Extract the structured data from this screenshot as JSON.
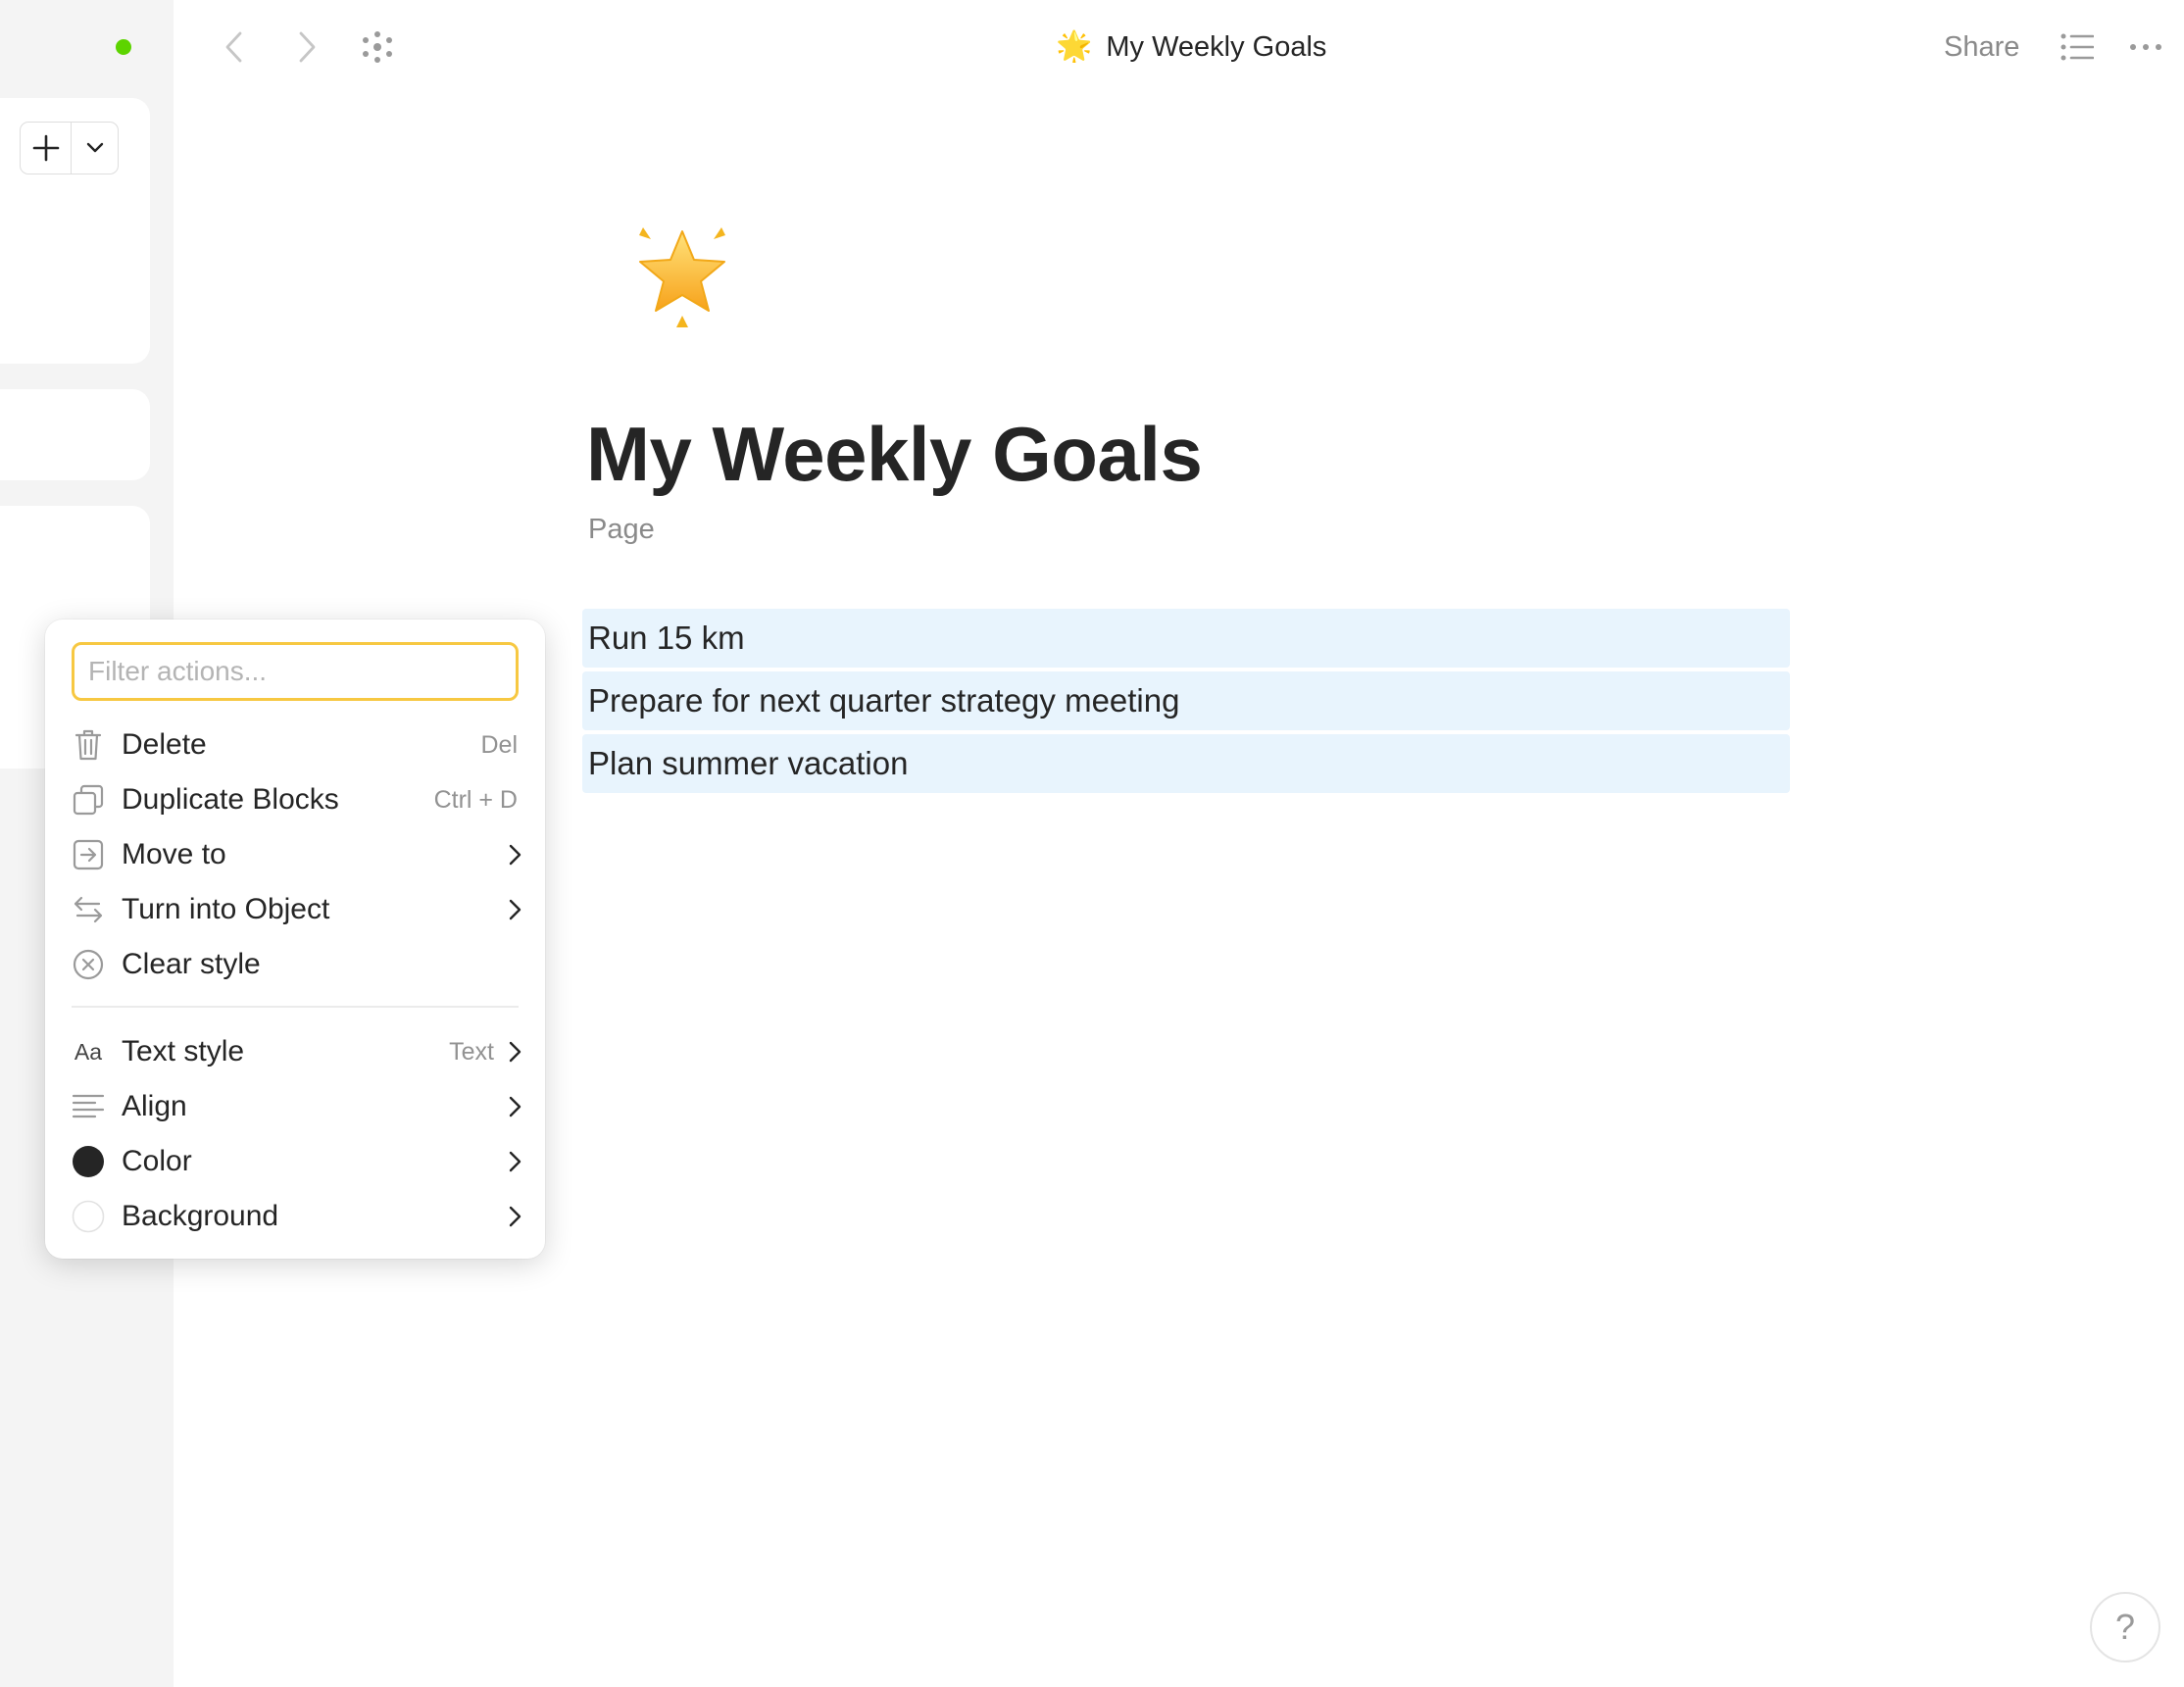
{
  "window": {
    "status_color": "#5dd400",
    "accent_color": "#f7c842",
    "selection_color": "#e8f4fd"
  },
  "sidebar": {
    "add_button_icon": "plus-icon",
    "add_dropdown_icon": "chevron-down-icon"
  },
  "header": {
    "back_icon": "chevron-left-icon",
    "forward_icon": "chevron-right-icon",
    "graph_icon": "graph-icon",
    "doc_emoji": "🌟",
    "doc_title": "My Weekly Goals",
    "share_label": "Share",
    "toc_icon": "list-icon",
    "more_icon": "more-icon"
  },
  "document": {
    "icon_emoji": "🌟",
    "title": "My Weekly Goals",
    "type_label": "Page",
    "blocks": [
      {
        "text": "Run 15 km"
      },
      {
        "text": "Prepare for next quarter strategy meeting"
      },
      {
        "text": "Plan summer vacation"
      }
    ]
  },
  "context_menu": {
    "filter_placeholder": "Filter actions...",
    "items": [
      {
        "label": "Delete",
        "shortcut": "Del",
        "icon": "trash-icon"
      },
      {
        "label": "Duplicate Blocks",
        "shortcut": "Ctrl + D",
        "icon": "duplicate-icon"
      },
      {
        "label": "Move to",
        "icon": "move-to-icon",
        "submenu": true
      },
      {
        "label": "Turn into Object",
        "icon": "turn-into-icon",
        "submenu": true
      },
      {
        "label": "Clear style",
        "icon": "clear-style-icon"
      }
    ],
    "style_items": [
      {
        "label": "Text style",
        "value": "Text",
        "icon": "text-style-icon",
        "glyph": "Aa",
        "submenu": true
      },
      {
        "label": "Align",
        "icon": "align-left-icon",
        "submenu": true
      },
      {
        "label": "Color",
        "icon": "color-swatch-icon",
        "color": "#252525",
        "submenu": true
      },
      {
        "label": "Background",
        "icon": "background-swatch-icon",
        "color": "#ffffff",
        "submenu": true
      }
    ]
  },
  "help": {
    "label": "?"
  }
}
